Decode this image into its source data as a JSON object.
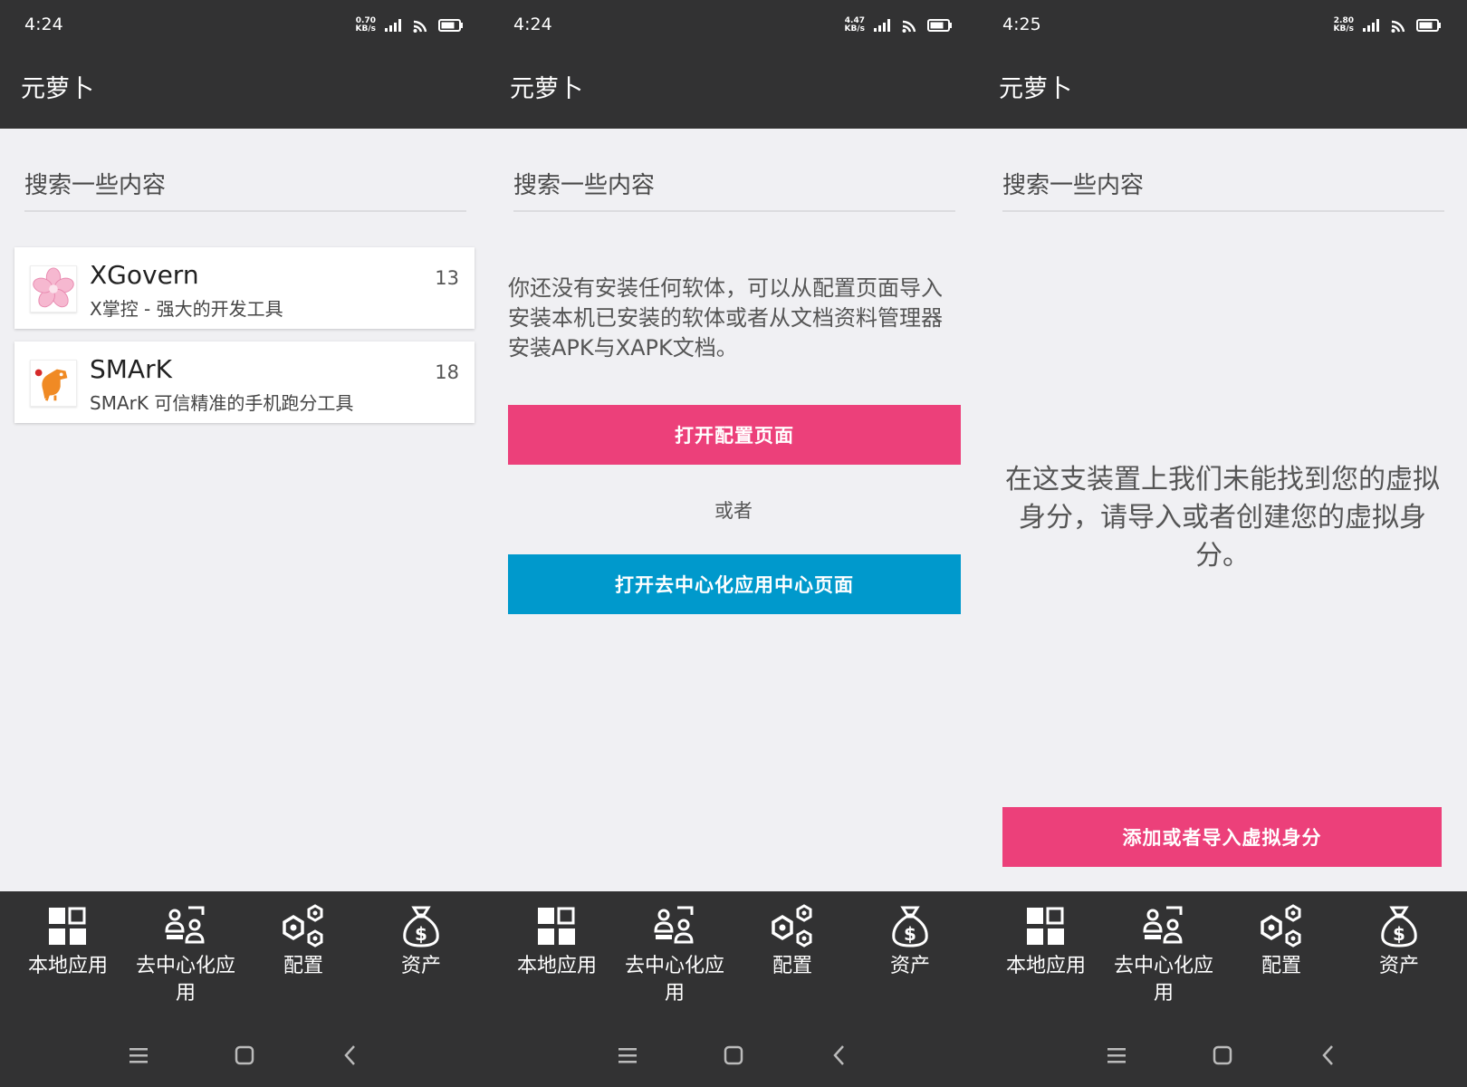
{
  "app_title": "元萝卜",
  "search_placeholder": "搜索一些内容",
  "colors": {
    "pink_button": "#ec407a",
    "blue_button": "#0099cc",
    "bar": "#323233",
    "background": "#f0f0f3"
  },
  "screens": [
    {
      "status": {
        "time": "4:24",
        "speed_value": "0.70",
        "speed_unit": "KB/s"
      },
      "apps": [
        {
          "name": "XGovern",
          "description": "X掌控 - 强大的开发工具",
          "count": "13",
          "icon": "sakura-flower-icon"
        },
        {
          "name": "SMArK",
          "description": "SMArK 可信精准的手机跑分工具",
          "count": "18",
          "icon": "orange-dinosaur-icon"
        }
      ]
    },
    {
      "status": {
        "time": "4:24",
        "speed_value": "4.47",
        "speed_unit": "KB/s"
      },
      "empty_message": "你还没有安装任何软体，可以从配置页面导入安装本机已安装的软体或者从文档资料管理器安装APK与XAPK文档。",
      "open_config_label": "打开配置页面",
      "or_label": "或者",
      "open_dapp_center_label": "打开去中心化应用中心页面"
    },
    {
      "status": {
        "time": "4:25",
        "speed_value": "2.80",
        "speed_unit": "KB/s"
      },
      "no_identity_message": "在这支装置上我们未能找到您的虚拟身分，请导入或者创建您的虚拟身分。",
      "add_identity_label": "添加或者导入虚拟身分"
    }
  ],
  "nav": [
    {
      "label": "本地应用",
      "icon": "grid-apps-icon"
    },
    {
      "label": "去中心化应用",
      "icon": "decentralized-icon"
    },
    {
      "label": "配置",
      "icon": "hexagon-settings-icon"
    },
    {
      "label": "资产",
      "icon": "money-bag-icon"
    }
  ],
  "status_icons": [
    "hd-signal-icon",
    "wifi-icon",
    "battery-icon"
  ],
  "system_nav": [
    "menu-icon",
    "home-icon",
    "back-icon"
  ]
}
